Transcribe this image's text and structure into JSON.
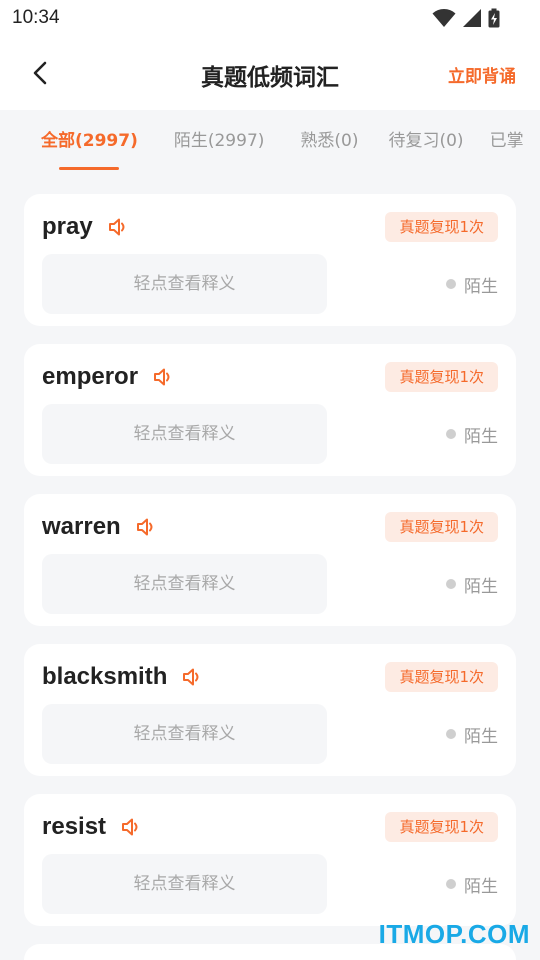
{
  "status_bar": {
    "time": "10:34",
    "icons": [
      "wifi-icon",
      "signal-icon",
      "battery-charging-icon"
    ]
  },
  "header": {
    "back_icon": "chevron-left-icon",
    "title": "真题低频词汇",
    "action_label": "立即背诵"
  },
  "tabs": [
    {
      "label": "全部(2997)",
      "active": true
    },
    {
      "label": "陌生(2997)",
      "active": false
    },
    {
      "label": "熟悉(0)",
      "active": false
    },
    {
      "label": "待复习(0)",
      "active": false
    },
    {
      "label": "已掌",
      "active": false
    }
  ],
  "words": [
    {
      "word": "pray",
      "badge": "真题复现1次",
      "reveal_hint": "轻点查看释义",
      "status": "陌生"
    },
    {
      "word": "emperor",
      "badge": "真题复现1次",
      "reveal_hint": "轻点查看释义",
      "status": "陌生"
    },
    {
      "word": "warren",
      "badge": "真题复现1次",
      "reveal_hint": "轻点查看释义",
      "status": "陌生"
    },
    {
      "word": "blacksmith",
      "badge": "真题复现1次",
      "reveal_hint": "轻点查看释义",
      "status": "陌生"
    },
    {
      "word": "resist",
      "badge": "真题复现1次",
      "reveal_hint": "轻点查看释义",
      "status": "陌生"
    }
  ],
  "watermark": "ITMOP.COM",
  "colors": {
    "accent": "#f56a2b",
    "badge_bg": "#fdebe3",
    "page_bg": "#f5f6f8",
    "watermark": "#19a9e6"
  }
}
